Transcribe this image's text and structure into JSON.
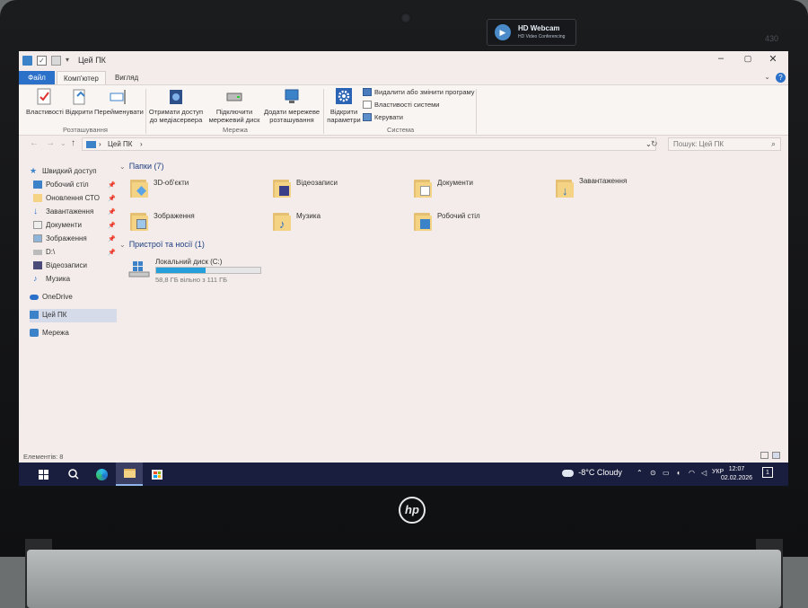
{
  "hardware": {
    "sticker_title": "HD Webcam",
    "sticker_subtitle": "HD Video Conferencing",
    "model_number": "430",
    "brand": "hp"
  },
  "window": {
    "title": "Цей ПК",
    "controls": [
      "–",
      "▢",
      "✕"
    ]
  },
  "ribbon": {
    "tabs": [
      "Файл",
      "Комп'ютер",
      "Вигляд"
    ],
    "groups": [
      {
        "label": "Розташування",
        "buttons": [
          "Властивості",
          "Відкрити",
          "Перейменувати"
        ]
      },
      {
        "label": "Мережа",
        "buttons": [
          "Отримати доступ до медіасервера",
          "Підключити мережевий диск",
          "Додати мережеве розташування"
        ]
      },
      {
        "label": "Система",
        "buttons": [
          "Відкрити параметри"
        ],
        "small_commands": [
          "Видалити або змінити програму",
          "Властивості системи",
          "Керувати"
        ]
      }
    ],
    "media_line1": "Отримати доступ",
    "media_line2": "до медіасервера",
    "map_line1": "Підключити",
    "map_line2": "мережевий диск",
    "addnet_line1": "Додати мережеве",
    "addnet_line2": "розташування",
    "open_line1": "Відкрити",
    "open_line2": "параметри"
  },
  "address": {
    "path": "Цей ПК",
    "separator": "›",
    "search_placeholder": "Пошук: Цей ПК"
  },
  "sidebar": {
    "items": [
      {
        "label": "Швидкий доступ",
        "pinned": false
      },
      {
        "label": "Робочий стіл",
        "pinned": true
      },
      {
        "label": "Оновлення СТО",
        "pinned": true
      },
      {
        "label": "Завантаження",
        "pinned": true
      },
      {
        "label": "Документи",
        "pinned": true
      },
      {
        "label": "Зображення",
        "pinned": true
      },
      {
        "label": "D:\\",
        "pinned": true
      },
      {
        "label": "Відеозаписи",
        "pinned": false
      },
      {
        "label": "Музика",
        "pinned": false
      },
      {
        "label": "OneDrive",
        "pinned": false
      },
      {
        "label": "Цей ПК",
        "pinned": false,
        "selected": true
      },
      {
        "label": "Мережа",
        "pinned": false
      }
    ]
  },
  "content": {
    "folders_heading": "Папки (7)",
    "folders": [
      "3D-об'єкти",
      "Відеозаписи",
      "Документи",
      "Завантаження",
      "Зображення",
      "Музика",
      "Робочий стіл"
    ],
    "devices_heading": "Пристрої та носії (1)",
    "drive": {
      "name": "Локальний диск (C:)",
      "free_text": "58,8 ГБ вільно з 111 ГБ",
      "used_fraction": 0.47
    }
  },
  "status": {
    "items_count": "Елементів: 8"
  },
  "taskbar": {
    "weather": "-8°C  Cloudy",
    "language": "УКР",
    "time": "12:07",
    "date": "02.02.2026",
    "notifications": "1"
  },
  "colors": {
    "accent": "#2b70c9",
    "folder": "#f4d384",
    "taskbar": "#1a1e3e",
    "drive_fill": "#26a0da"
  }
}
